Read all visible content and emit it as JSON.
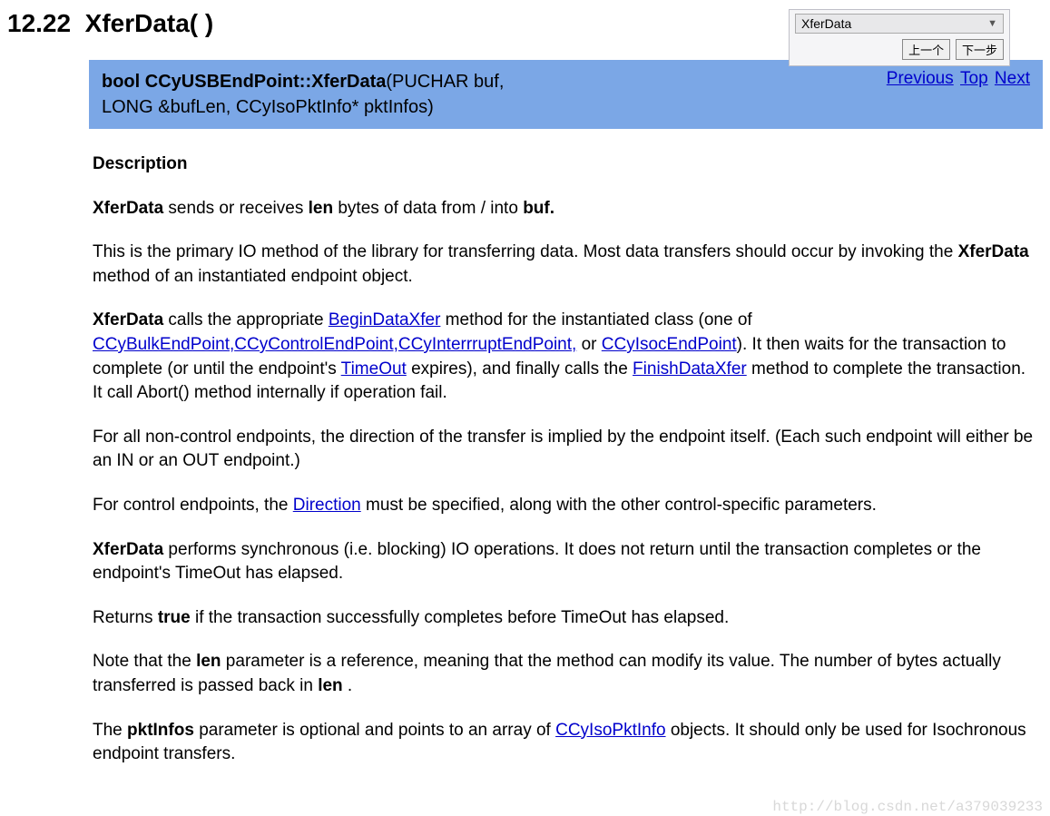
{
  "nav_widget": {
    "select_value": "XferData",
    "prev_btn": "上一个",
    "next_btn": "下一步"
  },
  "section_number": "12.22",
  "section_name": "XferData( )",
  "signature": {
    "ret_type": "bool",
    "qualified_name": "CCyUSBEndPoint::XferData",
    "params_line1": "(PUCHAR buf,",
    "params_line2": "LONG &bufLen, CCyIsoPktInfo* pktInfos)"
  },
  "navlinks": {
    "previous": "Previous",
    "top": "Top",
    "next": "Next"
  },
  "desc_heading": "Description",
  "p1": {
    "a": "XferData",
    "b": " sends or receives ",
    "c": "len",
    "d": " bytes of data from / into ",
    "e": "buf."
  },
  "p2": {
    "a": "This is the primary IO method of the library for transferring data. Most data transfers should occur by invoking the ",
    "b": "XferData",
    "c": " method of an instantiated endpoint object."
  },
  "p3": {
    "a": "XferData",
    "b": " calls the appropriate ",
    "l1": "BeginDataXfer",
    "c": " method for the instantiated class (one of ",
    "l2": "CCyBulkEndPoint,",
    "l3": "CCyControlEndPoint,",
    "l4": "CCyInterrruptEndPoint,",
    "d": " or ",
    "l5": "CCyIsocEndPoint",
    "e": "). It then waits for the transaction to complete (or until the endpoint's ",
    "l6": "TimeOut",
    "f": " expires), and finally calls the ",
    "l7": "FinishDataXfer",
    "g": " method to complete the transaction. It call Abort() method internally if operation fail."
  },
  "p4": "For all non-control endpoints, the direction of the transfer is implied by the endpoint itself. (Each such endpoint will either be an IN or an OUT endpoint.)",
  "p5": {
    "a": "For control endpoints, the ",
    "l1": "Direction",
    "b": " must be specified, along with the other control-specific parameters."
  },
  "p6": {
    "a": "XferData",
    "b": " performs synchronous (i.e. blocking) IO operations. It does not return until the transaction completes or the endpoint's TimeOut has elapsed."
  },
  "p7": {
    "a": "Returns ",
    "b": "true",
    "c": " if the transaction successfully completes before TimeOut has elapsed."
  },
  "p8": {
    "a": "Note that the ",
    "b": "len",
    "c": " parameter is a reference, meaning that the method can modify its value. The number of bytes actually transferred is passed back in ",
    "d": "len",
    "e": " ."
  },
  "p9": {
    "a": "The ",
    "b": "pktInfos",
    "c": " parameter is optional and points to an array of ",
    "l1": "CCyIsoPktInfo",
    "d": " objects. It should only be used for Isochronous endpoint transfers."
  },
  "watermark": "http://blog.csdn.net/a379039233"
}
